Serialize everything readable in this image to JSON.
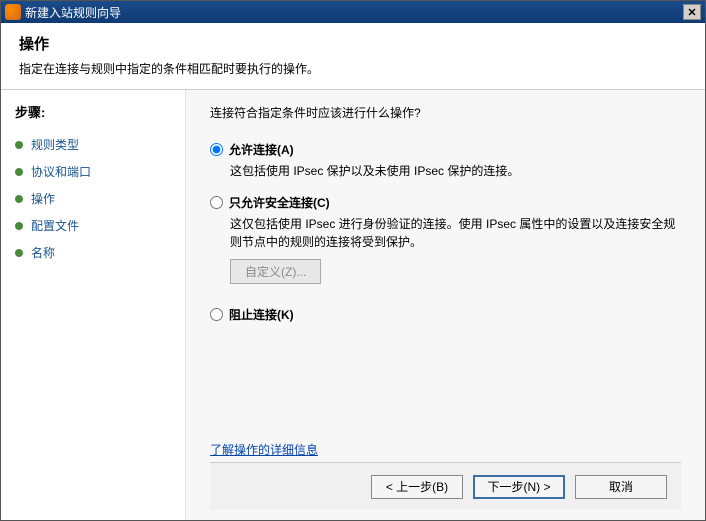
{
  "window": {
    "title": "新建入站规则向导"
  },
  "header": {
    "title": "操作",
    "subtitle": "指定在连接与规则中指定的条件相匹配时要执行的操作。"
  },
  "sidebar": {
    "title": "步骤:",
    "items": [
      {
        "label": "规则类型"
      },
      {
        "label": "协议和端口"
      },
      {
        "label": "操作"
      },
      {
        "label": "配置文件"
      },
      {
        "label": "名称"
      }
    ]
  },
  "content": {
    "question": "连接符合指定条件时应该进行什么操作?",
    "options": [
      {
        "label": "允许连接(A)",
        "desc": "这包括使用 IPsec 保护以及未使用 IPsec 保护的连接。",
        "checked": true
      },
      {
        "label": "只允许安全连接(C)",
        "desc": "这仅包括使用 IPsec 进行身份验证的连接。使用 IPsec 属性中的设置以及连接安全规则节点中的规则的连接将受到保护。",
        "checked": false
      },
      {
        "label": "阻止连接(K)",
        "desc": "",
        "checked": false
      }
    ],
    "custom_button": "自定义(Z)...",
    "learn_more": "了解操作的详细信息"
  },
  "footer": {
    "back": "< 上一步(B)",
    "next": "下一步(N) >",
    "cancel": "取消"
  }
}
